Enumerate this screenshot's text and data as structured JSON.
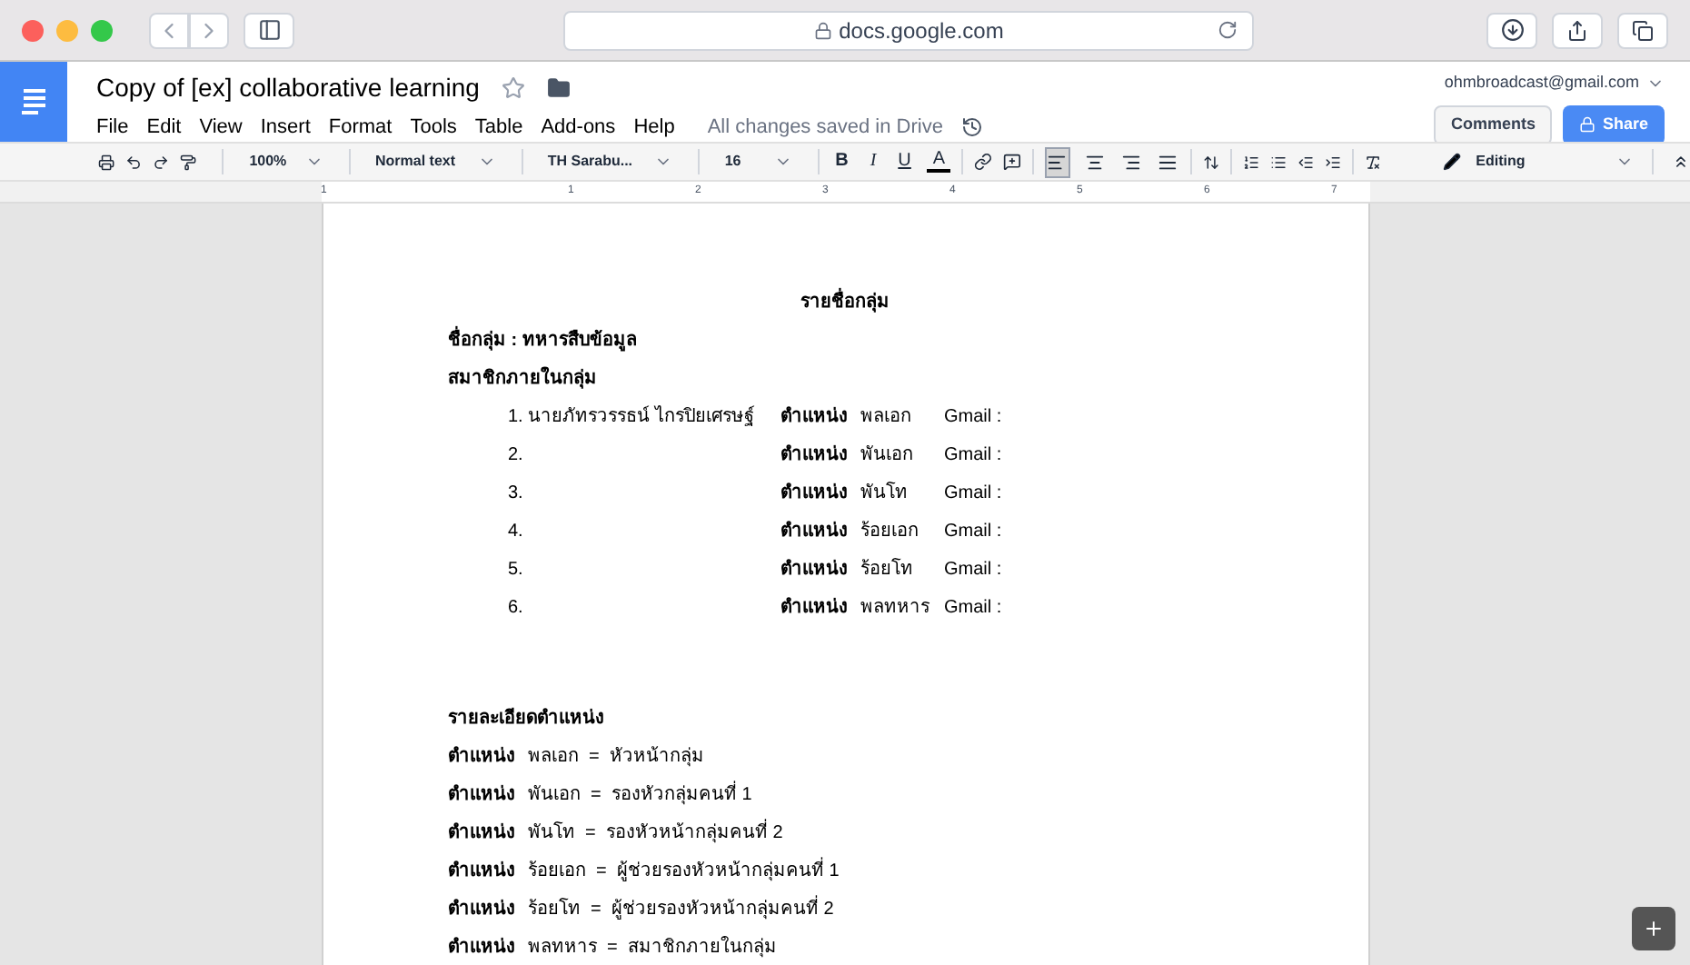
{
  "browser": {
    "url": "docs.google.com"
  },
  "doc_header": {
    "title": "Copy of [ex] collaborative learning",
    "starred": false,
    "account": "ohmbroadcast@gmail.com",
    "menu": [
      "File",
      "Edit",
      "View",
      "Insert",
      "Format",
      "Tools",
      "Table",
      "Add-ons",
      "Help"
    ],
    "save_status": "All changes saved in Drive",
    "comments_button": "Comments",
    "share_button": "Share"
  },
  "toolbar": {
    "zoom": "100%",
    "style": "Normal text",
    "font": "TH Sarabu...",
    "size": "16",
    "format_buttons": [
      "B",
      "I",
      "U",
      "A"
    ],
    "align_buttons": [
      {
        "selected": true
      },
      {
        "selected": false
      },
      {
        "selected": false
      },
      {
        "selected": false
      }
    ],
    "mode": "Editing"
  },
  "ruler": [
    "1",
    "1",
    "2",
    "3",
    "4",
    "5",
    "6",
    "7"
  ],
  "document": {
    "title": "รายชื่อกลุ่ม",
    "group_label": "ชื่อกลุ่ม : ทหารสืบข้อมูล",
    "members_label": "สมาชิกภายในกลุ่ม",
    "members": [
      {
        "number": "1. นายภัทรวรรธน์  ไกรปิยเศรษฐ์",
        "role_label": "ตำแหน่ง",
        "rank": "พลเอก",
        "gmail": "Gmail :"
      },
      {
        "number": "2.",
        "role_label": "ตำแหน่ง",
        "rank": "พันเอก",
        "gmail": "Gmail :"
      },
      {
        "number": "3.",
        "role_label": "ตำแหน่ง",
        "rank": "พันโท",
        "gmail": "Gmail :"
      },
      {
        "number": "4.",
        "role_label": "ตำแหน่ง",
        "rank": "ร้อยเอก",
        "gmail": "Gmail :"
      },
      {
        "number": "5.",
        "role_label": "ตำแหน่ง",
        "rank": "ร้อยโท",
        "gmail": "Gmail :"
      },
      {
        "number": "6.",
        "role_label": "ตำแหน่ง",
        "rank": "พลทหาร",
        "gmail": "Gmail :"
      }
    ],
    "details_label": "รายละเอียดตำแหน่ง",
    "details": [
      {
        "role_label": "ตำแหน่ง",
        "text": "พลเอก  =  หัวหน้ากลุ่ม"
      },
      {
        "role_label": "ตำแหน่ง",
        "text": "พันเอก  =  รองหัวกลุ่มคนที่ 1"
      },
      {
        "role_label": "ตำแหน่ง",
        "text": "พันโท  =  รองหัวหน้ากลุ่มคนที่ 2"
      },
      {
        "role_label": "ตำแหน่ง",
        "text": "ร้อยเอก  =  ผู้ช่วยรองหัวหน้ากลุ่มคนที่ 1"
      },
      {
        "role_label": "ตำแหน่ง",
        "text": "ร้อยโท  =  ผู้ช่วยรองหัวหน้ากลุ่มคนที่ 2"
      },
      {
        "role_label": "ตำแหน่ง",
        "text": "พลทหาร  =  สมาชิกภายในกลุ่ม"
      }
    ]
  }
}
